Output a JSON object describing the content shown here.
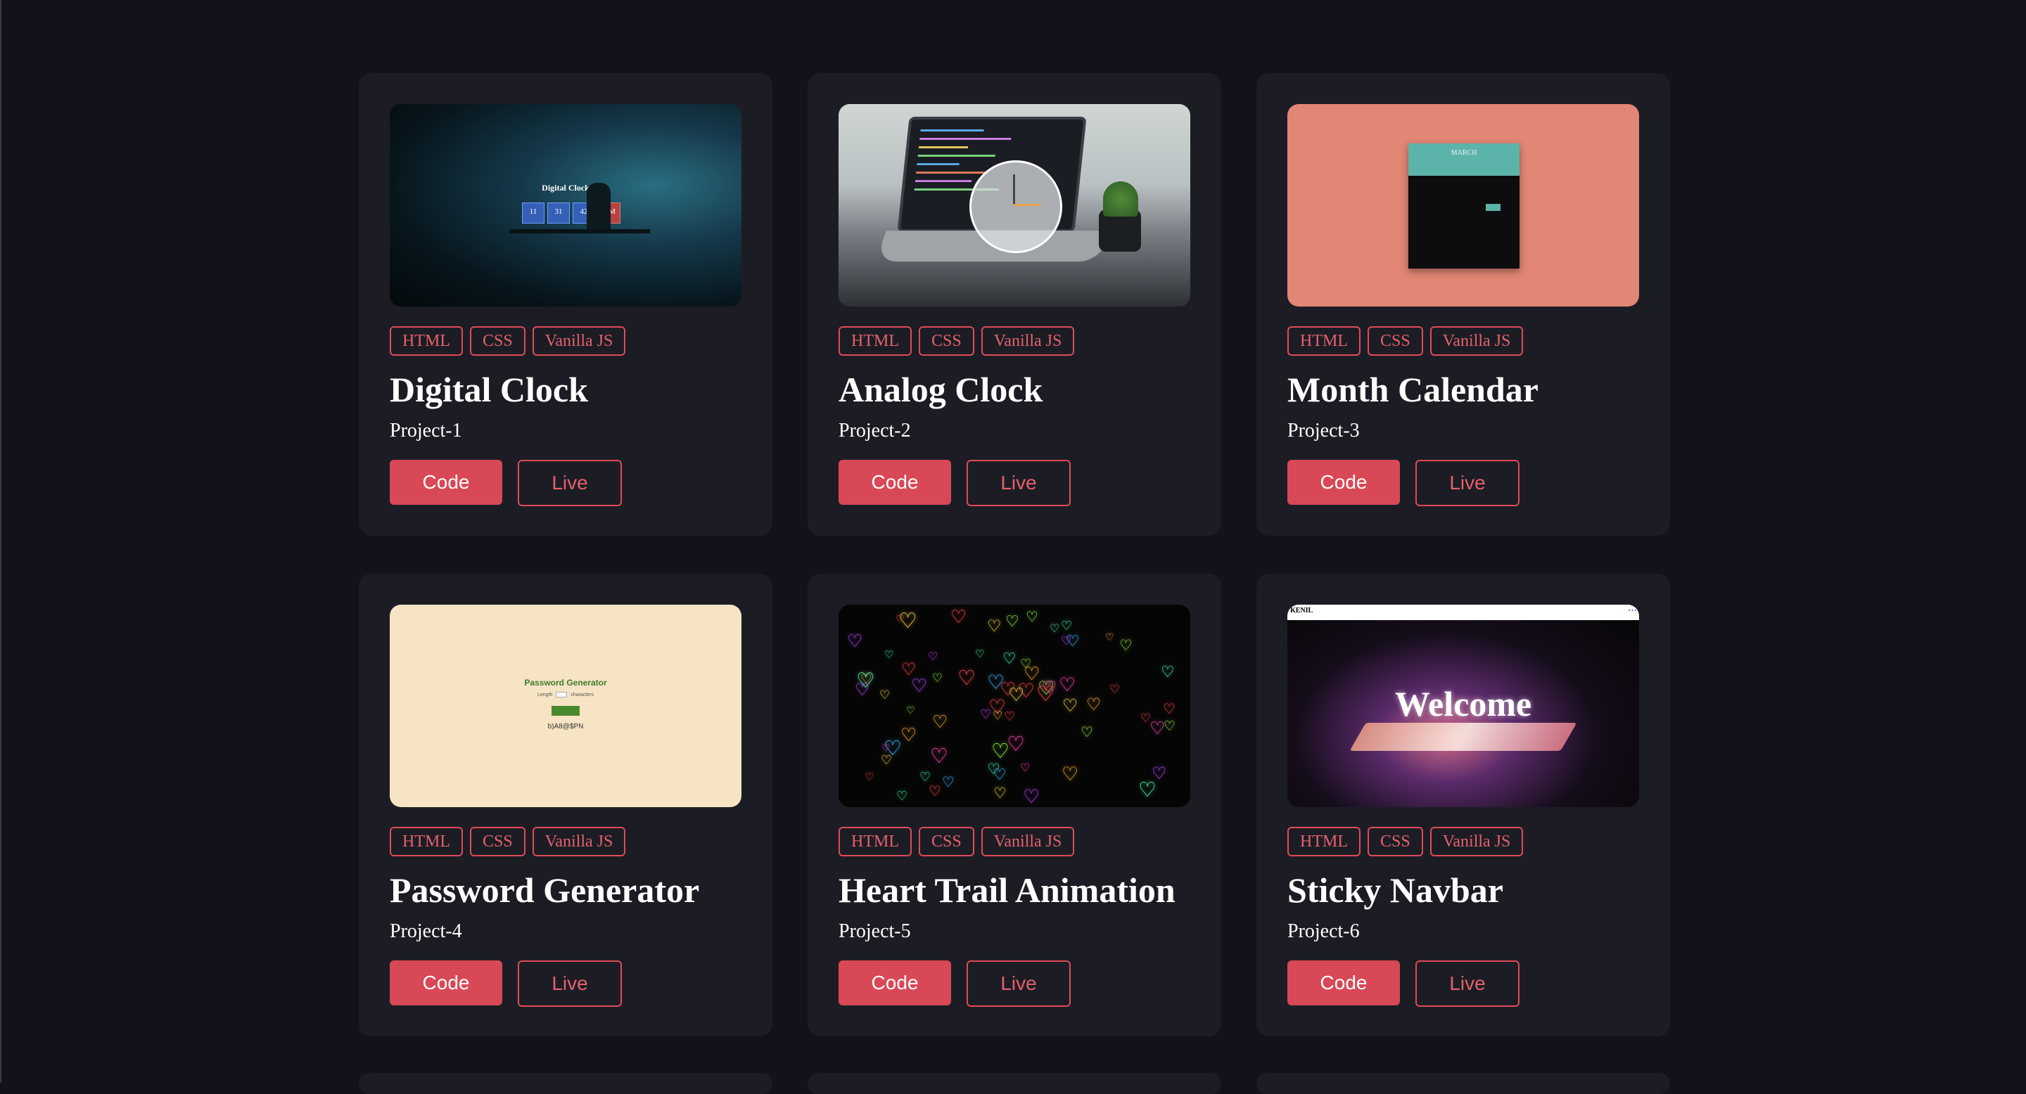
{
  "projects": [
    {
      "title": "Digital Clock",
      "subtitle": "Project-1",
      "tags": [
        "HTML",
        "CSS",
        "Vanilla JS"
      ],
      "code_label": "Code",
      "live_label": "Live",
      "thumb": {
        "caption": "Digital Clock",
        "values": [
          "11",
          "31",
          "42"
        ],
        "ampm": "AM"
      }
    },
    {
      "title": "Analog Clock",
      "subtitle": "Project-2",
      "tags": [
        "HTML",
        "CSS",
        "Vanilla JS"
      ],
      "code_label": "Code",
      "live_label": "Live"
    },
    {
      "title": "Month Calendar",
      "subtitle": "Project-3",
      "tags": [
        "HTML",
        "CSS",
        "Vanilla JS"
      ],
      "code_label": "Code",
      "live_label": "Live",
      "thumb": {
        "month": "MARCH"
      }
    },
    {
      "title": "Password Generator",
      "subtitle": "Project-4",
      "tags": [
        "HTML",
        "CSS",
        "Vanilla JS"
      ],
      "code_label": "Code",
      "live_label": "Live",
      "thumb": {
        "heading": "Password Generator",
        "length_label": "Length",
        "chars_label": "characters",
        "password": "b)A8@$PN"
      }
    },
    {
      "title": "Heart Trail Animation",
      "subtitle": "Project-5",
      "tags": [
        "HTML",
        "CSS",
        "Vanilla JS"
      ],
      "code_label": "Code",
      "live_label": "Live"
    },
    {
      "title": "Sticky Navbar",
      "subtitle": "Project-6",
      "tags": [
        "HTML",
        "CSS",
        "Vanilla JS"
      ],
      "code_label": "Code",
      "live_label": "Live",
      "thumb": {
        "brand": "KENIL",
        "headline": "Welcome"
      }
    }
  ],
  "colors": {
    "background": "#12131a",
    "card": "#1c1d24",
    "accent": "#d94856"
  }
}
